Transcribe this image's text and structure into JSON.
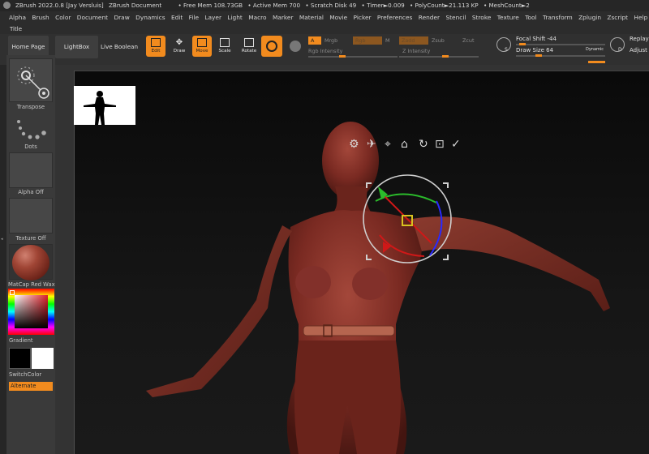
{
  "titlebar": {
    "app": "ZBrush 2022.0.8 [Jay Versluis]",
    "document": "ZBrush Document",
    "free_mem": "• Free Mem 108.73GB",
    "active_mem": "• Active Mem 700",
    "scratch": "• Scratch Disk 49",
    "timer": "• Timer►0.009",
    "polycount": "• PolyCount►21.113 KP",
    "meshcount": "• MeshCount►2"
  },
  "menu": [
    "Alpha",
    "Brush",
    "Color",
    "Document",
    "Draw",
    "Dynamics",
    "Edit",
    "File",
    "Layer",
    "Light",
    "Macro",
    "Marker",
    "Material",
    "Movie",
    "Picker",
    "Preferences",
    "Render",
    "Stencil",
    "Stroke",
    "Texture",
    "Tool",
    "Transform",
    "Zplugin",
    "Zscript",
    "Help"
  ],
  "title_label": "Title",
  "shelf": {
    "home_page": "Home Page",
    "lightbox": "LightBox",
    "live_boolean": "Live Boolean",
    "edit": "Edit",
    "draw": "Draw",
    "move": "Move",
    "scale": "Scale",
    "rotate": "Rotate",
    "a_label": "A",
    "mrgb": "Mrgb",
    "rgb": "Rgb",
    "m": "M",
    "zadd": "Zadd",
    "zsub": "Zsub",
    "zcut": "Zcut",
    "rgb_intensity": "Rgb Intensity",
    "z_intensity": "Z Intensity",
    "focal_shift": "Focal Shift",
    "focal_value": "-44",
    "draw_size": "Draw Size",
    "draw_value": "64",
    "dynamic": "Dynamic",
    "replay": "Replay",
    "adjust": "Adjust",
    "s_label": "S",
    "d_label": "D"
  },
  "left": {
    "transpose": "Transpose",
    "dots": "Dots",
    "alpha_off": "Alpha Off",
    "texture_off": "Texture Off",
    "matcap": "MatCap Red Wax",
    "gradient": "Gradient",
    "switch_color": "SwitchColor",
    "alternate": "Alternate"
  },
  "colors": {
    "accent": "#f28b1e",
    "skin": "#7a2a22",
    "panel": "#3a3a3a"
  }
}
